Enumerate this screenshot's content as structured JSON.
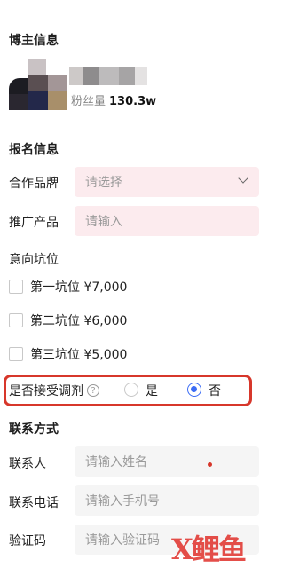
{
  "blogger": {
    "section_title": "博主信息",
    "fans_label": "粉丝量",
    "fans_value": "130.3w"
  },
  "signup": {
    "section_title": "报名信息",
    "brand_label": "合作品牌",
    "brand_placeholder": "请选择",
    "product_label": "推广产品",
    "product_placeholder": "请输入",
    "slot_label": "意向坑位",
    "slots": [
      {
        "label": "第一坑位 ¥7,000",
        "checked": false
      },
      {
        "label": "第二坑位 ¥6,000",
        "checked": false
      },
      {
        "label": "第三坑位 ¥5,000",
        "checked": false
      }
    ],
    "adjust_question": "是否接受调剂",
    "adjust_options": [
      {
        "label": "是",
        "selected": false
      },
      {
        "label": "否",
        "selected": true
      }
    ]
  },
  "contact": {
    "section_title": "联系方式",
    "name_label": "联系人",
    "name_placeholder": "请输入姓名",
    "phone_label": "联系电话",
    "phone_placeholder": "请输入手机号",
    "code_label": "验证码",
    "code_placeholder": "请输入验证码"
  },
  "watermark": {
    "text": "X鲤鱼"
  },
  "colors": {
    "highlight": "#d7372b",
    "radio_active": "#3b6cf5",
    "pink_field": "#fcebee",
    "gray_field": "#f5f5f5"
  }
}
